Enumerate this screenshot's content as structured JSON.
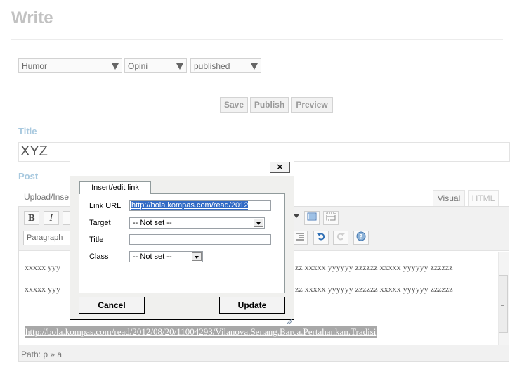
{
  "page": {
    "title": "Write"
  },
  "selects": {
    "category": "Humor",
    "type": "Opini",
    "status": "published"
  },
  "actions": {
    "save": "Save",
    "publish": "Publish",
    "preview": "Preview"
  },
  "title_section": {
    "label": "Title",
    "value": "XYZ"
  },
  "post_section": {
    "label": "Post",
    "upload_label": "Upload/Inse",
    "tab_visual": "Visual",
    "tab_html": "HTML"
  },
  "toolbar": {
    "bold": "B",
    "italic": "I",
    "format_value": "Paragraph"
  },
  "content": {
    "line1_left": "xxxxx yyy",
    "line1_right": "zz xxxxx yyyyyy zzzzzz xxxxx yyyyyy zzzzzz",
    "line2_left": "xxxxx yyy",
    "line2_right": "zz xxxxx yyyyyy zzzzzz xxxxx yyyyyy zzzzzz",
    "selected_link": "http://bola.kompas.com/read/2012/08/20/11004293/Vilanova.Senang.Barca.Pertahankan.Tradisi"
  },
  "path_bar": {
    "text": "Path: p » a"
  },
  "dialog": {
    "close_label": "✕",
    "tab_label": "Insert/edit link",
    "link_url_label": "Link URL",
    "link_url_value": "http://bola.kompas.com/read/2012",
    "target_label": "Target",
    "target_value": "-- Not set --",
    "title_label": "Title",
    "title_value": "",
    "class_label": "Class",
    "class_value": "-- Not set --",
    "cancel_label": "Cancel",
    "update_label": "Update"
  },
  "colors": {
    "section_label": "#a8c9df",
    "selection": "#316ac5",
    "visual_tab_text": "#777777",
    "html_tab_text": "#bbbbbb"
  }
}
